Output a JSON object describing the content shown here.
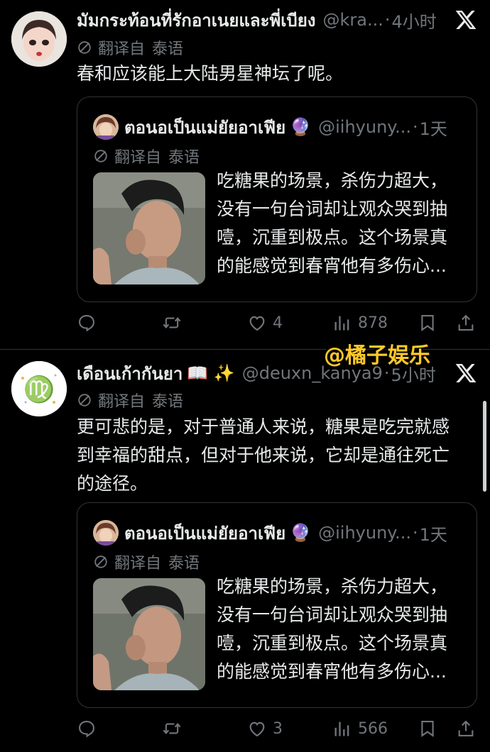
{
  "posts": [
    {
      "author_name": "มัมกระท้อนที่รักอาเนยและพี่เบียง",
      "emoji": "",
      "handle": "@kra...",
      "time": "4小时",
      "translate_label": "翻译自",
      "translate_lang": "泰语",
      "text_lines": [
        "春和应该能上大陆男星神坛了呢。"
      ],
      "quote": {
        "author_name": "ตอนอเป็นแม่ยัยอาเฟีย",
        "emoji": "🔮",
        "handle": "@iihyuny...",
        "time": "1天",
        "translate_label": "翻译自",
        "translate_lang": "泰语",
        "text_lines": [
          "吃糖果的场景，杀伤力超大，",
          "没有一句台词却让观众哭到抽",
          "噎，沉重到极点。这个场景真",
          "的能感觉到春宵他有多伤心..."
        ]
      },
      "actions": {
        "replies": "",
        "reposts": "",
        "likes": "4",
        "views": "878"
      }
    },
    {
      "author_name": "เดือนเก้ากันยา",
      "emoji": "📖 ✨",
      "handle": "@deuxn_kanya9",
      "time": "5小时",
      "translate_label": "翻译自",
      "translate_lang": "泰语",
      "text_lines": [
        "更可悲的是，对于普通人来说，糖果是吃完就感",
        "到幸福的甜点，但对于他来说，它却是通往死亡",
        "的途径。"
      ],
      "quote": {
        "author_name": "ตอนอเป็นแม่ยัยอาเฟีย",
        "emoji": "🔮",
        "handle": "@iihyuny...",
        "time": "1天",
        "translate_label": "翻译自",
        "translate_lang": "泰语",
        "text_lines": [
          "吃糖果的场景，杀伤力超大，",
          "没有一句台词却让观众哭到抽",
          "噎，沉重到极点。这个场景真",
          "的能感觉到春宵他有多伤心..."
        ]
      },
      "actions": {
        "replies": "",
        "reposts": "",
        "likes": "3",
        "views": "566"
      }
    }
  ],
  "watermark": "@橘子娱乐",
  "colors": {
    "background": "#000000",
    "text": "#e7e9ea",
    "muted": "#71767b",
    "border": "#2f3336",
    "watermark": "#ffc928"
  },
  "icons": [
    "x-logo-icon",
    "translate-icon",
    "reply-icon",
    "repost-icon",
    "like-icon",
    "views-icon",
    "bookmark-icon",
    "share-icon"
  ]
}
